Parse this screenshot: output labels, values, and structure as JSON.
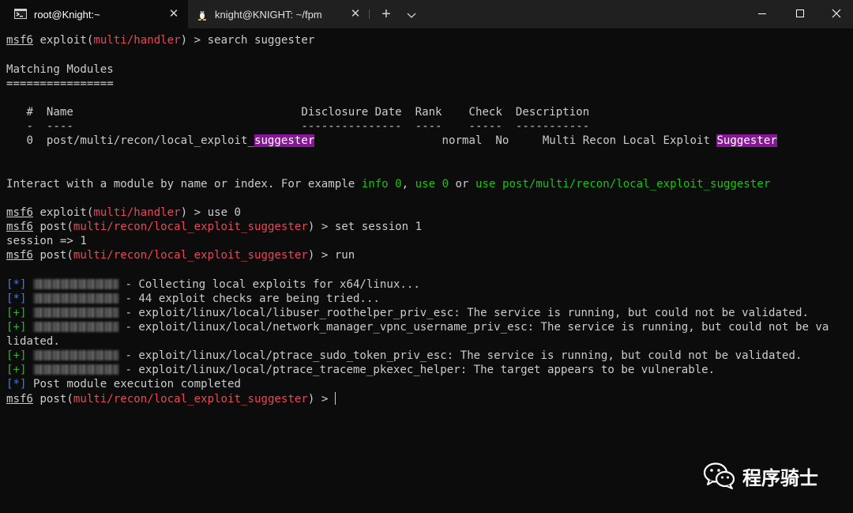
{
  "tabs": [
    {
      "label": "root@Knight:~",
      "icon": "cmd-icon",
      "active": true
    },
    {
      "label": "knight@KNIGHT: ~/fpm",
      "icon": "linux-penguin-icon",
      "active": false
    }
  ],
  "tab_close_glyph": "✕",
  "new_tab_glyph": "+",
  "colors": {
    "background": "#0c0c0c",
    "text": "#cccccc",
    "red": "#e74856",
    "green": "#16c60c",
    "blue": "#3b78ff",
    "highlight": "#881798"
  },
  "terminal": {
    "prompt_app": "msf6",
    "l1": {
      "ctx_open": " exploit(",
      "module": "multi/handler",
      "ctx_close": ") > ",
      "cmd": "search suggester"
    },
    "matching_title": "Matching Modules",
    "matching_rule": "================",
    "table_header": "   #  Name                                  Disclosure Date  Rank    Check  Description",
    "table_rule": "   -  ----                                  ---------------  ----    -----  -----------",
    "row_prefix": "   0  post/multi/recon/local_exploit_",
    "row_match": "suggester",
    "row_middle": "                   normal  No     Multi Recon Local Exploit ",
    "row_desc_match": "Suggester",
    "interact_text": "Interact with a module by name or index. For example ",
    "interact_ex1": "info 0",
    "interact_sep1": ", ",
    "interact_ex2": "use 0",
    "interact_sep2": " or ",
    "interact_ex3": "use post/multi/recon/local_exploit_suggester",
    "l2": {
      "ctx_open": " exploit(",
      "module": "multi/handler",
      "ctx_close": ") > ",
      "cmd": "use 0"
    },
    "post_module": "multi/recon/local_exploit_suggester",
    "post_open": " post(",
    "post_close": ") > ",
    "cmd_set": "set session 1",
    "session_out": "session => 1",
    "cmd_run": "run",
    "tag_info": "[*]",
    "tag_good": "[+]",
    "out": [
      {
        "tag": "info",
        "text": " - Collecting local exploits for x64/linux..."
      },
      {
        "tag": "info",
        "text": " - 44 exploit checks are being tried..."
      },
      {
        "tag": "good",
        "text": " - exploit/linux/local/libuser_roothelper_priv_esc: The service is running, but could not be validated."
      },
      {
        "tag": "good",
        "text": " - exploit/linux/local/network_manager_vpnc_username_priv_esc: The service is running, but could not be va"
      },
      {
        "tag": "good",
        "text": " - exploit/linux/local/ptrace_sudo_token_priv_esc: The service is running, but could not be validated."
      },
      {
        "tag": "good",
        "text": " - exploit/linux/local/ptrace_traceme_pkexec_helper: The target appears to be vulnerable."
      }
    ],
    "wrap_cont": "lidated.",
    "post_done": " Post module execution completed"
  },
  "watermark": {
    "text": "程序骑士",
    "icon": "wechat-icon"
  }
}
